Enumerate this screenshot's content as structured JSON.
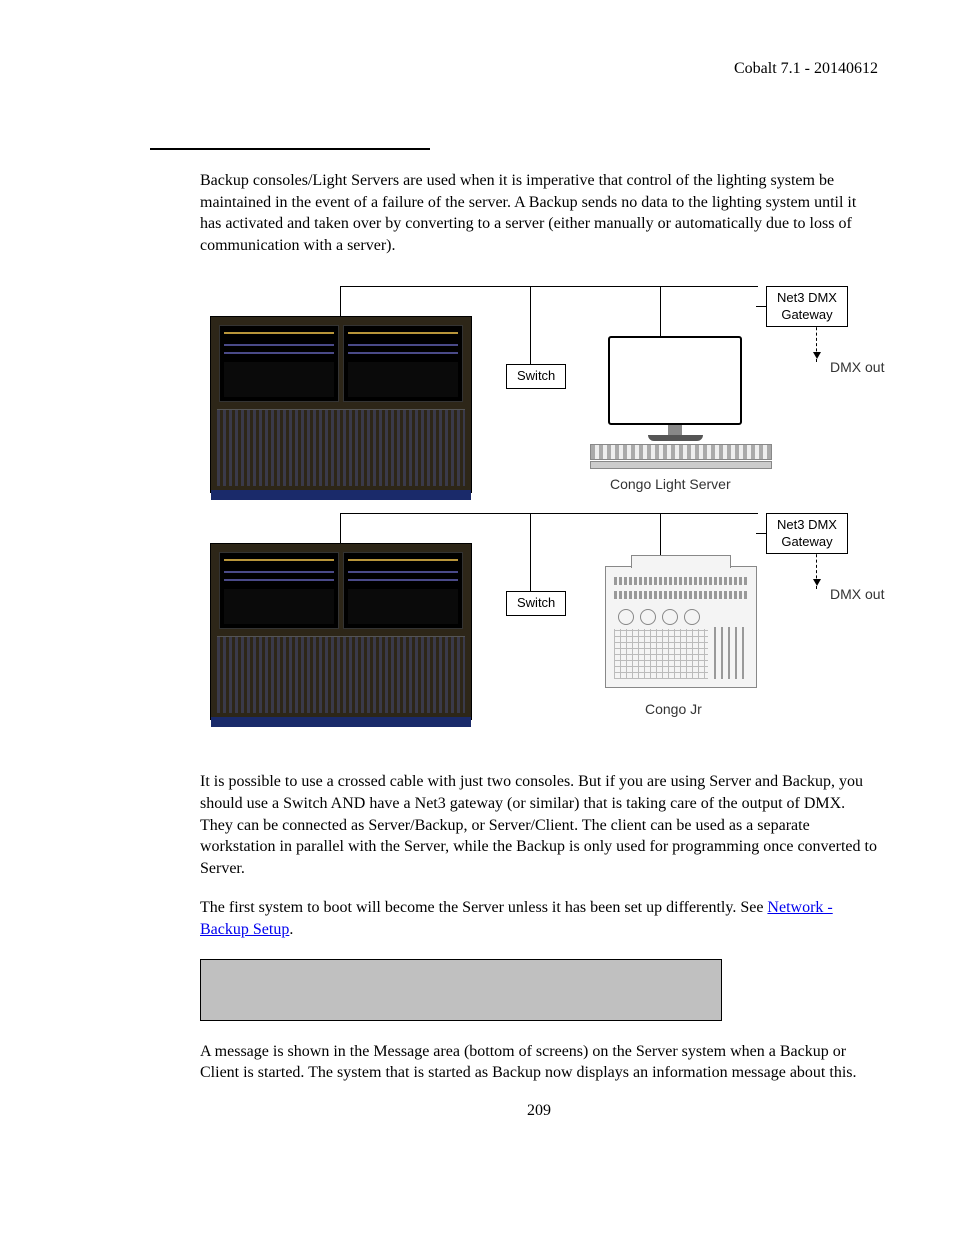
{
  "header": {
    "doc_id": "Cobalt 7.1 - 20140612"
  },
  "paragraphs": {
    "p1": "Backup consoles/Light Servers are used when it is imperative that control of the lighting system be maintained in the event of a failure of the server. A Backup sends no data to the lighting system until it has activated and taken over by converting to a server (either manually or automatically due to loss of communication with a server).",
    "p2": "It is possible to use a crossed cable with just two consoles. But if you are using Server and Backup, you should use a Switch AND have a Net3 gateway (or similar) that is taking care of the output of DMX. They can be connected as Server/Backup, or Server/Client. The client can be used as a separate workstation in parallel with the Server, while the Backup is only used for programming once converted to Server.",
    "p3_a": "The first system to boot will become the Server unless it has been set up differently. See ",
    "p3_link": "Network - Backup Setup",
    "p3_b": ".",
    "p4": "A message is shown in the Message area (bottom of screens) on the Server system when a Backup or Client is started. The system that is started as Backup now displays an information message about this."
  },
  "diagram": {
    "switch": "Switch",
    "gateway_line1": "Net3 DMX",
    "gateway_line2": "Gateway",
    "dmx_out": "DMX out",
    "light_server": "Congo Light Server",
    "congo_jr": "Congo Jr"
  },
  "page_number": "209"
}
